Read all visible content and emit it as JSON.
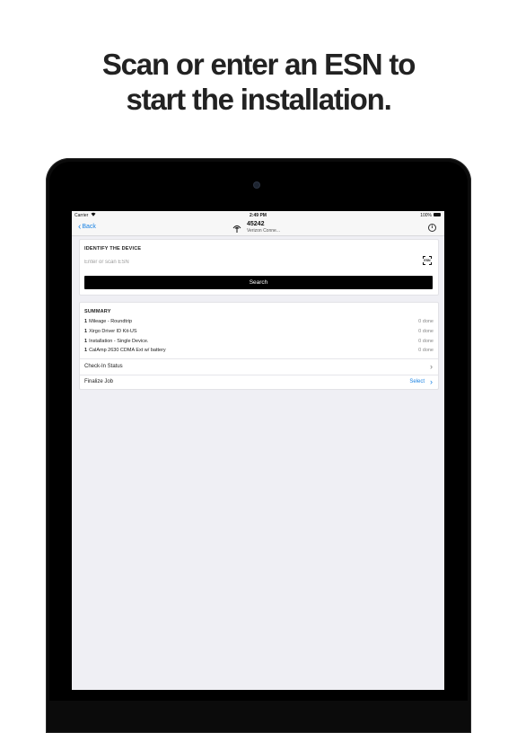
{
  "headline": {
    "line1": "Scan or enter an ESN to",
    "line2": "start the installation."
  },
  "status_bar": {
    "carrier": "Carrier",
    "wifi_icon": "wifi-icon",
    "time": "2:49 PM",
    "battery": "100%",
    "battery_icon": "battery-icon"
  },
  "nav": {
    "back_label": "Back",
    "title": "45242",
    "subtitle": "Verizon Conne...",
    "info_label": "i",
    "antenna_icon": "antenna-icon"
  },
  "identify": {
    "title": "IDENTIFY THE DEVICE",
    "esn_value": "",
    "esn_placeholder": "Enter or scan ESN",
    "scan_label": "ESN",
    "search_label": "Search"
  },
  "summary": {
    "title": "SUMMARY",
    "items": [
      {
        "qty": "1",
        "name": "Mileage - Roundtrip",
        "status": "0 done"
      },
      {
        "qty": "1",
        "name": "Xirgo Driver ID Kit-US",
        "status": "0 done"
      },
      {
        "qty": "1",
        "name": "Installation - Single Device.",
        "status": "0 done"
      },
      {
        "qty": "1",
        "name": "CalAmp 2630 CDMA Ext w/ battery",
        "status": "0 done"
      }
    ],
    "checkin_label": "Check-In Status",
    "finalize_label": "Finalize Job",
    "finalize_action": "Select"
  },
  "colors": {
    "accent": "#1a82e2",
    "headline": "#222222",
    "bezel": "#0b0b0b",
    "screen_bg": "#efeff4"
  }
}
